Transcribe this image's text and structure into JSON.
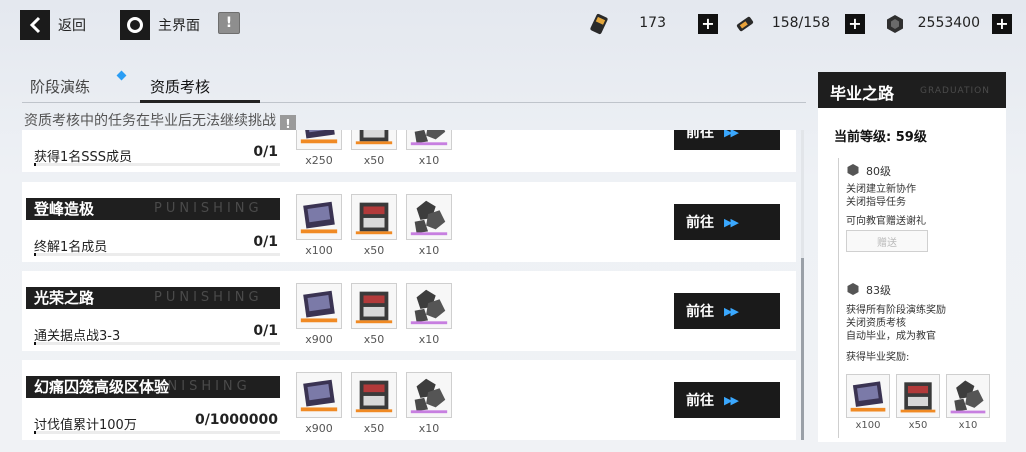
{
  "topbar": {
    "back_label": "返回",
    "home_label": "主界面",
    "alert_glyph": "!",
    "resources": [
      {
        "icon": "energy-ticket-icon",
        "value": "173"
      },
      {
        "icon": "serum-battery-icon",
        "value": "158/158"
      },
      {
        "icon": "coin-icon",
        "value": "2553400"
      }
    ],
    "plus_glyph": "+"
  },
  "tabs": [
    {
      "label": "阶段演练",
      "active": false,
      "has_dot": true
    },
    {
      "label": "资质考核",
      "active": true
    }
  ],
  "notice": "资质考核中的任务在毕业后无法继续挑战",
  "notice_icon_glyph": "!",
  "tasks": [
    {
      "title": "",
      "bg_word": "",
      "desc": "获得1名SSS成员",
      "progress": "0/1",
      "progress_fraction": 0,
      "rewards": [
        {
          "item": "ticket",
          "qty": "x250"
        },
        {
          "item": "supply",
          "qty": "x50"
        },
        {
          "item": "ore",
          "qty": "x10"
        }
      ],
      "button": "前往"
    },
    {
      "title": "登峰造极",
      "bg_word": "PUNISHING",
      "desc": "终解1名成员",
      "progress": "0/1",
      "progress_fraction": 0,
      "rewards": [
        {
          "item": "ticket",
          "qty": "x100"
        },
        {
          "item": "supply",
          "qty": "x50"
        },
        {
          "item": "ore",
          "qty": "x10"
        }
      ],
      "button": "前往"
    },
    {
      "title": "光荣之路",
      "bg_word": "PUNISHING",
      "desc": "通关据点战3-3",
      "progress": "0/1",
      "progress_fraction": 0,
      "rewards": [
        {
          "item": "ticket",
          "qty": "x900"
        },
        {
          "item": "supply",
          "qty": "x50"
        },
        {
          "item": "ore",
          "qty": "x10"
        }
      ],
      "button": "前往"
    },
    {
      "title": "幻痛囚笼高级区体验",
      "bg_word": "UNISHING",
      "desc": "讨伐值累计100万",
      "progress": "0/1000000",
      "progress_fraction": 0,
      "rewards": [
        {
          "item": "ticket",
          "qty": "x900"
        },
        {
          "item": "supply",
          "qty": "x50"
        },
        {
          "item": "ore",
          "qty": "x10"
        }
      ],
      "button": "前往"
    }
  ],
  "arrow_glyph": "▶▶",
  "panel": {
    "title": "毕业之路",
    "bg_word": "GRADUATION",
    "level_text": "当前等级:  59级",
    "stages": [
      {
        "level": "80级",
        "lines": [
          "关闭建立新协作",
          "关闭指导任务"
        ],
        "extra": "可向教官赠送谢礼",
        "button": "赠送"
      },
      {
        "level": "83级",
        "lines": [
          "获得所有阶段演练奖励",
          "关闭资质考核",
          "自动毕业，成为教官"
        ],
        "extra": "获得毕业奖励:"
      }
    ],
    "rewards": [
      {
        "item": "ticket",
        "qty": "x100"
      },
      {
        "item": "supply",
        "qty": "x50"
      },
      {
        "item": "ore",
        "qty": "x10"
      }
    ]
  },
  "colors": {
    "accent": "#2a9df4",
    "dark": "#1b1b1b",
    "ticket_orange": "#f08a24",
    "ore_purple": "#c77fe0"
  }
}
